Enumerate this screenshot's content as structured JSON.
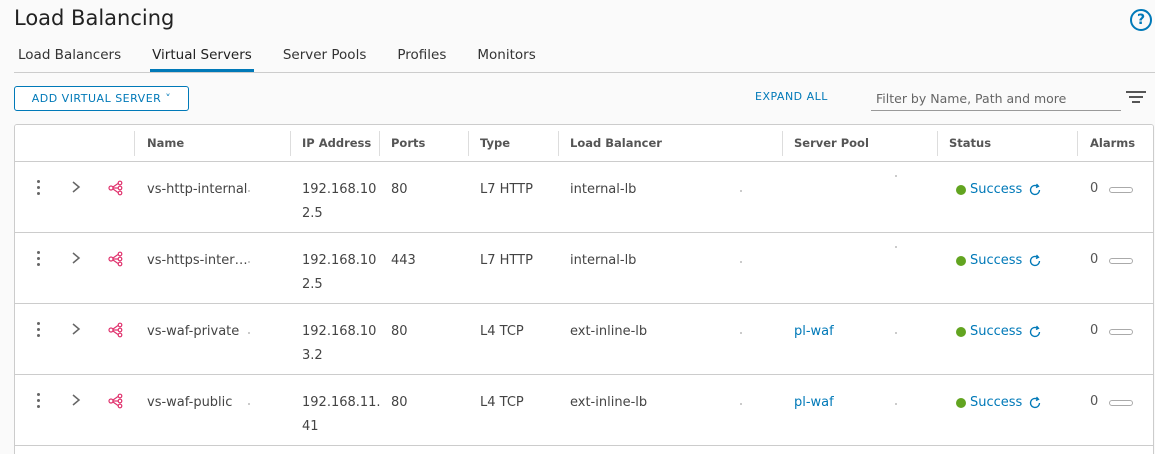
{
  "page": {
    "title": "Load Balancing",
    "help_icon": "question-circle-icon"
  },
  "tabs": [
    {
      "label": "Load Balancers",
      "active": false
    },
    {
      "label": "Virtual Servers",
      "active": true
    },
    {
      "label": "Server Pools",
      "active": false
    },
    {
      "label": "Profiles",
      "active": false
    },
    {
      "label": "Monitors",
      "active": false
    }
  ],
  "toolbar": {
    "add_label": "ADD VIRTUAL SERVER ˅",
    "expand_all_label": "EXPAND ALL",
    "filter_placeholder": "Filter by Name, Path and more"
  },
  "grid": {
    "columns": [
      "Name",
      "IP Address",
      "Ports",
      "Type",
      "Load Balancer",
      "Server Pool",
      "Status",
      "Alarms"
    ],
    "rows": [
      {
        "name": "vs-http-internal",
        "ip": "192.168.102.5",
        "ports": "80",
        "type": "L7 HTTP",
        "load_balancer": "internal-lb",
        "server_pool": "",
        "status": "Success",
        "alarms": "0"
      },
      {
        "name": "vs-https-inter…",
        "ip": "192.168.102.5",
        "ports": "443",
        "type": "L7 HTTP",
        "load_balancer": "internal-lb",
        "server_pool": "",
        "status": "Success",
        "alarms": "0"
      },
      {
        "name": "vs-waf-private",
        "ip": "192.168.103.2",
        "ports": "80",
        "type": "L4 TCP",
        "load_balancer": "ext-inline-lb",
        "server_pool": "pl-waf",
        "status": "Success",
        "alarms": "0"
      },
      {
        "name": "vs-waf-public",
        "ip": "192.168.11.41",
        "ports": "80",
        "type": "L4 TCP",
        "load_balancer": "ext-inline-lb",
        "server_pool": "pl-waf",
        "status": "Success",
        "alarms": "0"
      }
    ]
  },
  "colors": {
    "accent": "#0079b8",
    "success": "#62a420",
    "virtual_server_icon": "#e0336e"
  }
}
